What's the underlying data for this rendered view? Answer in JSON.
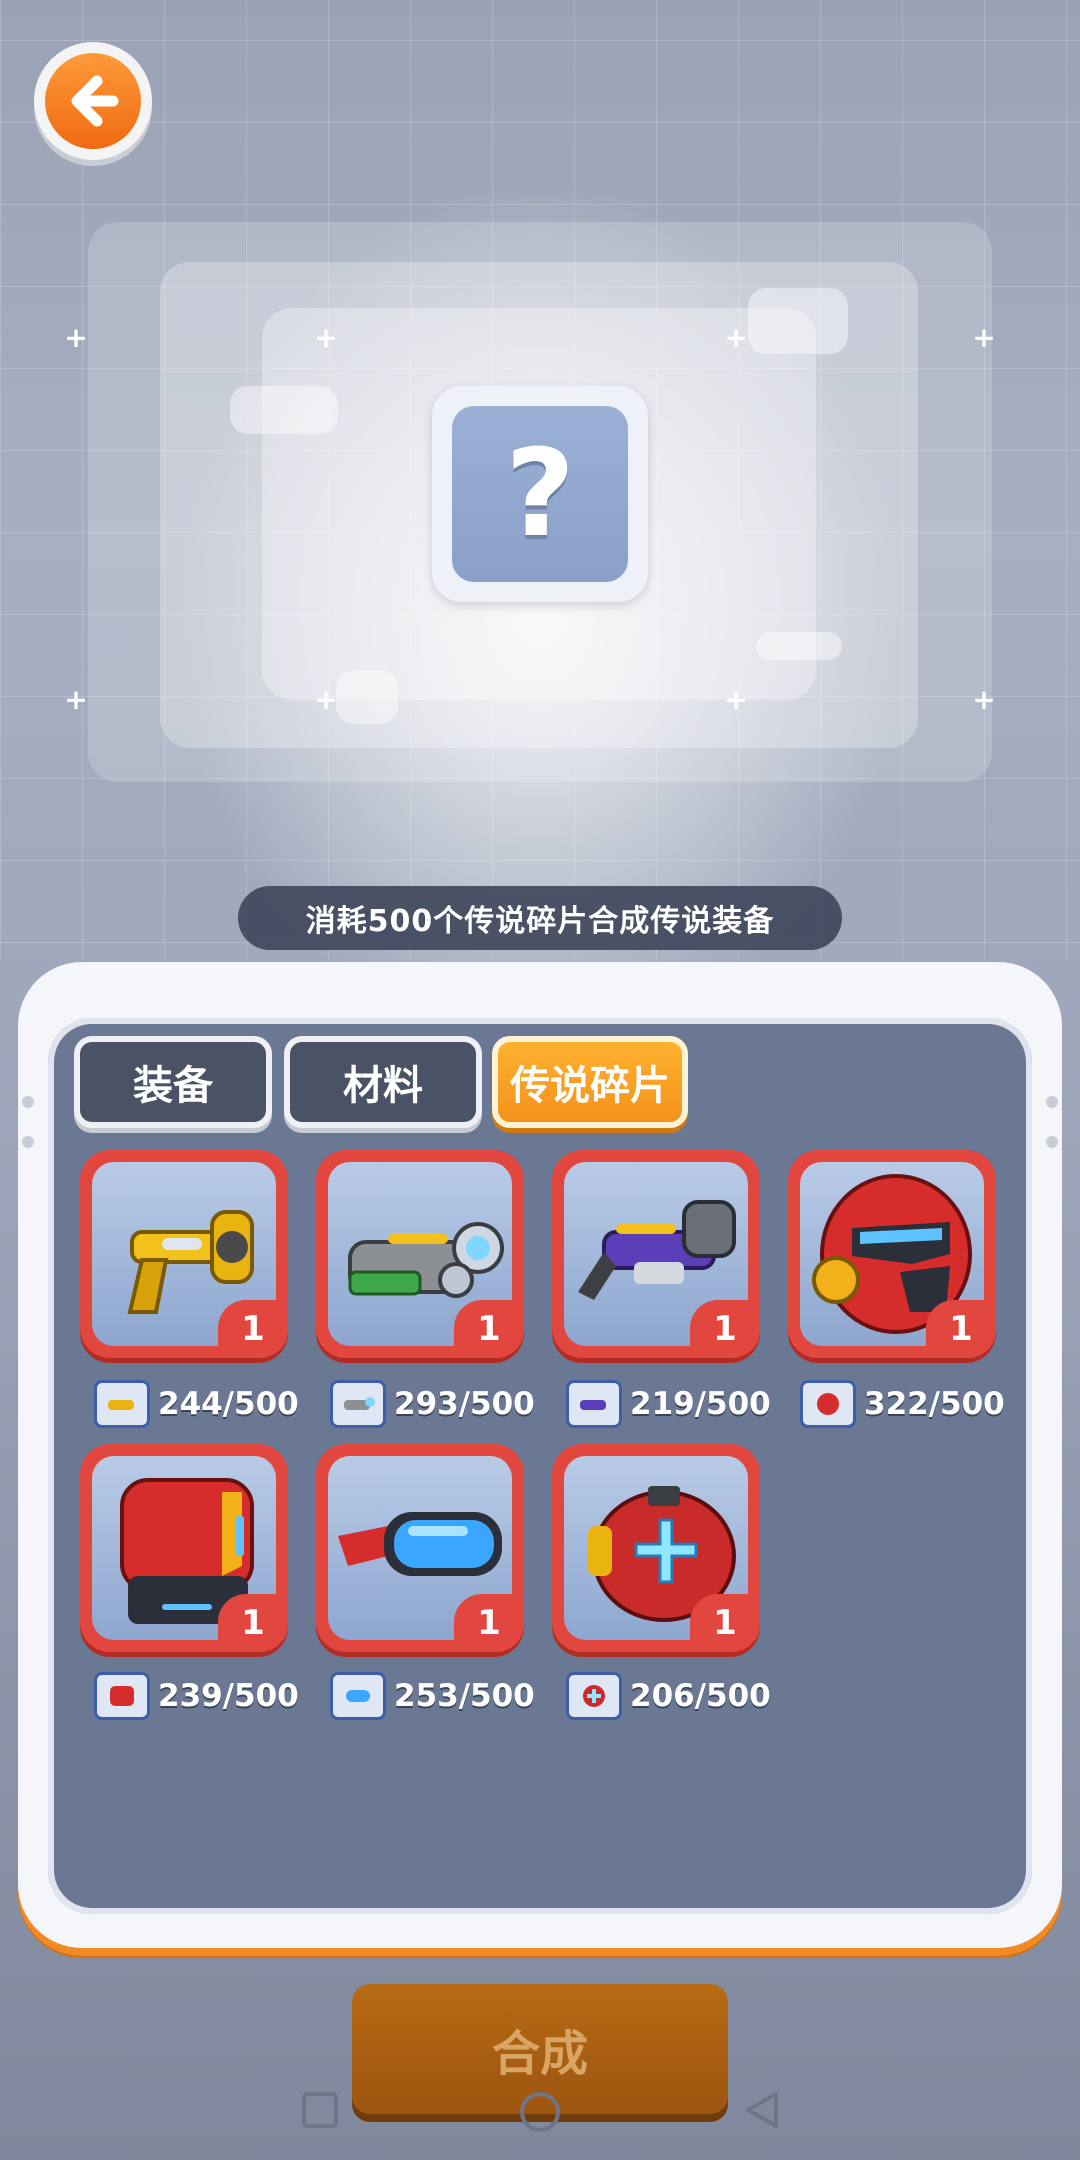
{
  "header": {
    "back_icon": "arrow-left-icon"
  },
  "preview": {
    "symbol": "?"
  },
  "caption": "消耗500个传说碎片合成传说装备",
  "tabs": [
    {
      "label": "装备",
      "active": false
    },
    {
      "label": "材料",
      "active": false
    },
    {
      "label": "传说碎片",
      "active": true
    }
  ],
  "items": [
    {
      "name": "gold-blaster",
      "count": "1",
      "progress": "244/500"
    },
    {
      "name": "green-cannon",
      "count": "1",
      "progress": "293/500"
    },
    {
      "name": "purple-rifle",
      "count": "1",
      "progress": "219/500"
    },
    {
      "name": "red-helmet",
      "count": "1",
      "progress": "322/500"
    },
    {
      "name": "red-armor",
      "count": "1",
      "progress": "239/500"
    },
    {
      "name": "blue-goggles",
      "count": "1",
      "progress": "253/500"
    },
    {
      "name": "red-backpack",
      "count": "1",
      "progress": "206/500"
    }
  ],
  "synthesize_label": "合成",
  "colors": {
    "accent": "#f3921c",
    "card": "#e2473f",
    "panel": "#6b7894"
  }
}
